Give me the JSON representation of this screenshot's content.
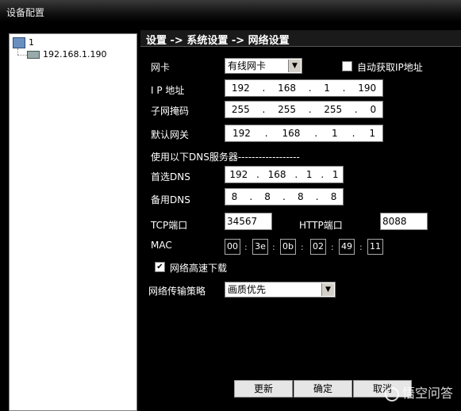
{
  "window": {
    "title": "设备配置"
  },
  "tree": {
    "root_label": "1",
    "child_label": "192.168.1.190"
  },
  "panel": {
    "breadcrumb": "设置 -> 系统设置 -> 网络设置"
  },
  "form": {
    "nic_label": "网卡",
    "nic_value": "有线网卡",
    "auto_ip_label": "自动获取IP地址",
    "auto_ip_checked": false,
    "ip_label": "I P 地址",
    "ip": [
      "192",
      "168",
      "1",
      "190"
    ],
    "mask_label": "子网掩码",
    "mask": [
      "255",
      "255",
      "255",
      "0"
    ],
    "gateway_label": "默认网关",
    "gateway": [
      "192",
      "168",
      "1",
      "1"
    ],
    "dns_section_label": "使用以下DNS服务器------------------",
    "dns_primary_label": "首选DNS",
    "dns_primary": [
      "192",
      "168",
      "1",
      "1"
    ],
    "dns_backup_label": "备用DNS",
    "dns_backup": [
      "8",
      "8",
      "8",
      "8"
    ],
    "tcp_label": "TCP端口",
    "tcp_value": "34567",
    "http_label": "HTTP端口",
    "http_value": "8088",
    "mac_label": "MAC",
    "mac": [
      "00",
      "3e",
      "0b",
      "02",
      "49",
      "11"
    ],
    "fast_download_label": "网络高速下载",
    "fast_download_checked": true,
    "strategy_label": "网络传输策略",
    "strategy_value": "画质优先"
  },
  "buttons": {
    "refresh": "更新",
    "ok": "确定",
    "cancel": "取消"
  },
  "watermark": {
    "text": "悟空问答"
  }
}
